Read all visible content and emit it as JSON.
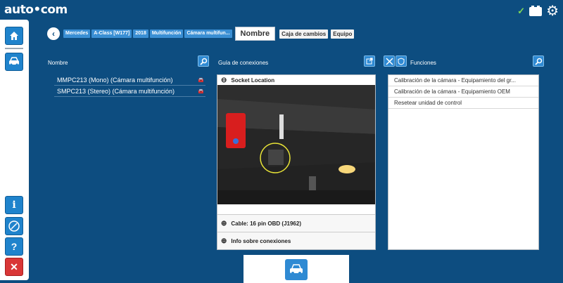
{
  "app": {
    "logo": "auto•com"
  },
  "status": {
    "check_icon": "checkmark-icon",
    "battery_icon": "battery-icon",
    "settings_icon": "gear-icon"
  },
  "sidebar": {
    "items": [
      {
        "icon": "home-icon"
      },
      {
        "icon": "car-settings-icon"
      },
      {
        "icon": "info-icon"
      },
      {
        "icon": "connection-icon"
      },
      {
        "icon": "help-icon"
      },
      {
        "icon": "close-icon"
      }
    ]
  },
  "breadcrumb": {
    "back_icon": "back-arrow-icon",
    "items": [
      "Mercedes",
      "A-Class [W177]",
      "2018",
      "Multifunción",
      "Cámara multifun..."
    ],
    "active_tab": "Nombre",
    "tabs": [
      "Caja de cambios",
      "Equipo"
    ]
  },
  "left_panel": {
    "header": "Nombre",
    "rows": [
      {
        "label": "MMPC213 (Mono) (Cámara multifunción)"
      },
      {
        "label": "SMPC213 (Stereo) (Cámara multifunción)"
      }
    ]
  },
  "guide_panel": {
    "header": "Guía de conexiones",
    "section_open": "Socket Location",
    "cable": "Cable: 16 pin OBD (J1962)",
    "info": "Info sobre conexiones"
  },
  "functions_panel": {
    "header": "Funciones",
    "items": [
      "Calibración de la cámara - Equipamiento del gr...",
      "Calibración de la cámara - Equipamiento OEM",
      "Resetear unidad de control"
    ]
  },
  "colors": {
    "background": "#0d4d80",
    "accent": "#2f8ad3",
    "crumb": "#3a8fd4",
    "danger": "#d93636"
  }
}
